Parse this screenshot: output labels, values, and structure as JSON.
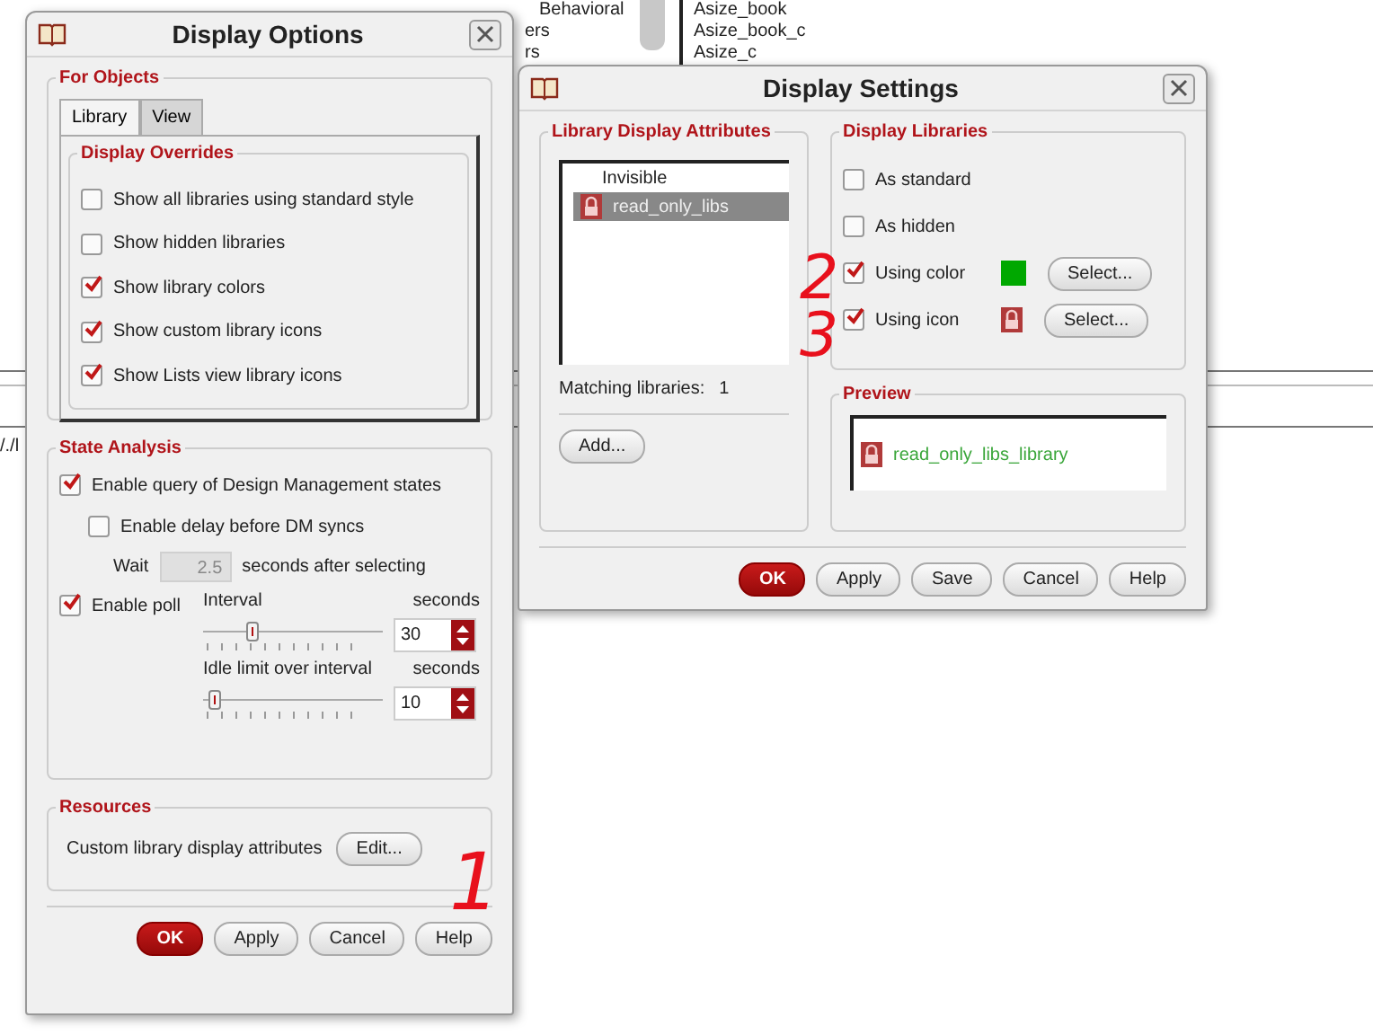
{
  "background": {
    "tree_item": "Behavioral",
    "fragments": [
      "ers",
      "rs"
    ],
    "list_items": [
      "Asize_book",
      "Asize_book_c",
      "Asize_c"
    ],
    "path_fragment": "/./l"
  },
  "display_options": {
    "title": "Display Options",
    "for_objects": {
      "title": "For Objects",
      "tabs": [
        {
          "label": "Library",
          "selected": true
        },
        {
          "label": "View",
          "selected": false
        }
      ],
      "group_title": "Display Overrides",
      "options": [
        {
          "label": "Show all libraries using standard style",
          "checked": false
        },
        {
          "label": "Show hidden libraries",
          "checked": false
        },
        {
          "label": "Show library colors",
          "checked": true
        },
        {
          "label": "Show custom library icons",
          "checked": true
        },
        {
          "label": "Show Lists view library icons",
          "checked": true
        }
      ]
    },
    "state_analysis": {
      "title": "State Analysis",
      "enable_query": {
        "label": "Enable query of Design Management states",
        "checked": true
      },
      "enable_delay": {
        "label": "Enable delay before DM syncs",
        "checked": false
      },
      "wait_label": "Wait",
      "wait_value": "2.5",
      "wait_suffix": "seconds after selecting",
      "enable_poll": {
        "label": "Enable poll",
        "checked": true
      },
      "sliders": [
        {
          "label": "Interval",
          "unit": "seconds",
          "level": 0.27,
          "value": "30"
        },
        {
          "label": "Idle limit over interval",
          "unit": "seconds",
          "level": 0.06,
          "value": "10"
        }
      ]
    },
    "resources": {
      "title": "Resources",
      "label": "Custom library display attributes",
      "button": "Edit..."
    },
    "buttons": [
      {
        "label": "OK",
        "kind": "default"
      },
      {
        "label": "Apply",
        "kind": "normal"
      },
      {
        "label": "Cancel",
        "kind": "normal"
      },
      {
        "label": "Help",
        "kind": "normal"
      }
    ]
  },
  "display_settings": {
    "title": "Display Settings",
    "attributes": {
      "title": "Library Display Attributes",
      "items": [
        {
          "label": "Invisible",
          "icon": false,
          "selected": false
        },
        {
          "label": "read_only_libs",
          "icon": true,
          "selected": true
        }
      ],
      "matching_label": "Matching libraries:",
      "matching_count": "1",
      "button": "Add..."
    },
    "libraries": {
      "title": "Display Libraries",
      "options": [
        {
          "label": "As standard",
          "checked": false,
          "kind": "plain"
        },
        {
          "label": "As hidden",
          "checked": false,
          "kind": "plain"
        },
        {
          "label": "Using color",
          "checked": true,
          "kind": "color",
          "color": "#00a800",
          "button": "Select..."
        },
        {
          "label": "Using icon",
          "checked": true,
          "kind": "icon",
          "button": "Select..."
        }
      ]
    },
    "preview": {
      "title": "Preview",
      "text": "read_only_libs_library"
    },
    "buttons": [
      {
        "label": "OK",
        "kind": "default"
      },
      {
        "label": "Apply",
        "kind": "normal"
      },
      {
        "label": "Save",
        "kind": "normal"
      },
      {
        "label": "Cancel",
        "kind": "normal"
      },
      {
        "label": "Help",
        "kind": "normal"
      }
    ]
  },
  "annotations": [
    "1",
    "2",
    "3"
  ]
}
